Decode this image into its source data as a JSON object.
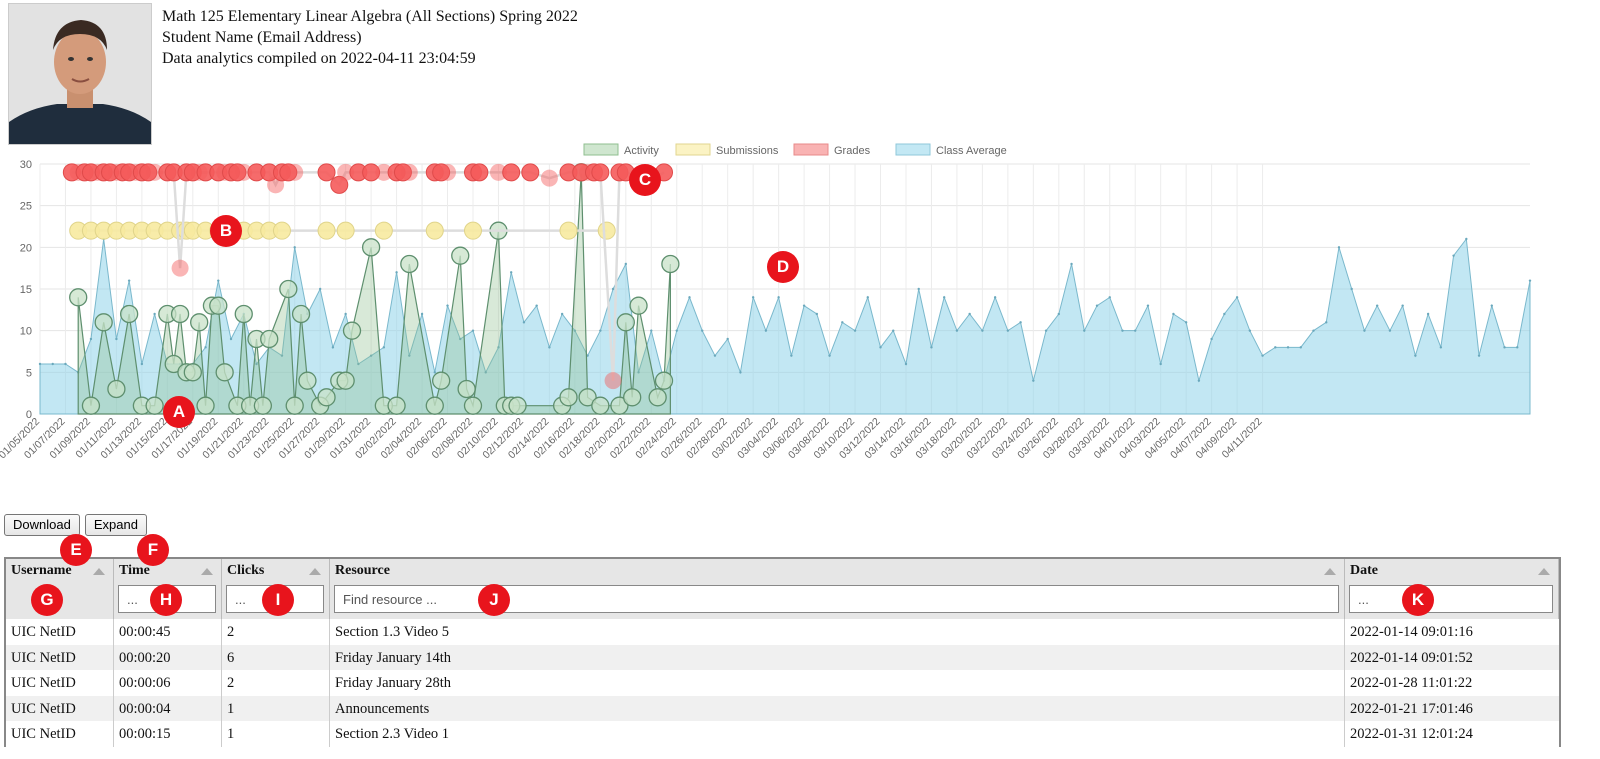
{
  "header": {
    "course": "Math 125 Elementary Linear Algebra (All Sections) Spring 2022",
    "student": "Student Name (Email Address)",
    "compiled": "Data analytics compiled on 2022-04-11 23:04:59"
  },
  "chart_data": {
    "type": "line",
    "legend": {
      "placement": "top-center",
      "items": [
        "Activity",
        "Submissions",
        "Grades",
        "Class Average"
      ]
    },
    "colors": {
      "Activity": "#8fbf8f",
      "Submissions": "#f7eaa0",
      "Grades": "#f55b5b",
      "Class Average": "#8fd3ea"
    },
    "ylim": [
      0,
      30
    ],
    "yticks": [
      0,
      5,
      10,
      15,
      20,
      25,
      30
    ],
    "xlabels": [
      "01/05/2022",
      "01/07/2022",
      "01/09/2022",
      "01/11/2022",
      "01/13/2022",
      "01/15/2022",
      "01/17/2022",
      "01/19/2022",
      "01/21/2022",
      "01/23/2022",
      "01/25/2022",
      "01/27/2022",
      "01/29/2022",
      "01/31/2022",
      "02/02/2022",
      "02/04/2022",
      "02/06/2022",
      "02/08/2022",
      "02/10/2022",
      "02/12/2022",
      "02/14/2022",
      "02/16/2022",
      "02/18/2022",
      "02/20/2022",
      "02/22/2022",
      "02/24/2022",
      "02/26/2022",
      "02/28/2022",
      "03/02/2022",
      "03/04/2022",
      "03/06/2022",
      "03/08/2022",
      "03/10/2022",
      "03/12/2022",
      "03/14/2022",
      "03/16/2022",
      "03/18/2022",
      "03/20/2022",
      "03/22/2022",
      "03/24/2022",
      "03/26/2022",
      "03/28/2022",
      "03/30/2022",
      "04/01/2022",
      "04/03/2022",
      "04/05/2022",
      "04/07/2022",
      "04/09/2022",
      "04/11/2022"
    ],
    "grid": true,
    "series": [
      {
        "name": "Class Average",
        "values": [
          6,
          6,
          6,
          5,
          9,
          21,
          9,
          16,
          6,
          12,
          6,
          6,
          6,
          8,
          16,
          9,
          12,
          6,
          8,
          7,
          20,
          12,
          15,
          8,
          12,
          6,
          7,
          8,
          17,
          7,
          12,
          5,
          13,
          9,
          10,
          5,
          8,
          17,
          11,
          13,
          8,
          12,
          10,
          7,
          10,
          15,
          18,
          5,
          10,
          4,
          10,
          14,
          10,
          7,
          9,
          5,
          14,
          10,
          14,
          7,
          13,
          12,
          7,
          11,
          10,
          14,
          8,
          10,
          6,
          15,
          8,
          14,
          10,
          12,
          10,
          14,
          10,
          11,
          4,
          10,
          12,
          18,
          10,
          13,
          14,
          10,
          10,
          13,
          6,
          12,
          11,
          4,
          9,
          12,
          14,
          10,
          7,
          8,
          8,
          8,
          10,
          11,
          20,
          15,
          10,
          13,
          10,
          13,
          7,
          12,
          8,
          19,
          21,
          7,
          13,
          8,
          8,
          16
        ]
      },
      {
        "name": "Activity",
        "points": [
          [
            3,
            14
          ],
          [
            4,
            1
          ],
          [
            5,
            11
          ],
          [
            6,
            3
          ],
          [
            7,
            12
          ],
          [
            8,
            1
          ],
          [
            9,
            1
          ],
          [
            10,
            12
          ],
          [
            10.5,
            6
          ],
          [
            11,
            12
          ],
          [
            11.5,
            5
          ],
          [
            12,
            5
          ],
          [
            12.5,
            11
          ],
          [
            13,
            1
          ],
          [
            13.5,
            13
          ],
          [
            14,
            13
          ],
          [
            14.5,
            5
          ],
          [
            15.5,
            1
          ],
          [
            16,
            12
          ],
          [
            16.5,
            1
          ],
          [
            17,
            9
          ],
          [
            17.5,
            1
          ],
          [
            18,
            9
          ],
          [
            19.5,
            15
          ],
          [
            20,
            1
          ],
          [
            20.5,
            12
          ],
          [
            21,
            4
          ],
          [
            22,
            1
          ],
          [
            22.5,
            2
          ],
          [
            23.5,
            4
          ],
          [
            24,
            4
          ],
          [
            24.5,
            10
          ],
          [
            26,
            20
          ],
          [
            27,
            1
          ],
          [
            28,
            1
          ],
          [
            29,
            18
          ],
          [
            31,
            1
          ],
          [
            31.5,
            4
          ],
          [
            33,
            19
          ],
          [
            33.5,
            3
          ],
          [
            34,
            1
          ],
          [
            36,
            22
          ],
          [
            36.5,
            1
          ],
          [
            37,
            1
          ],
          [
            37.5,
            1
          ],
          [
            41,
            1
          ],
          [
            41.5,
            2
          ],
          [
            42.5,
            29
          ],
          [
            43,
            2
          ],
          [
            44,
            1
          ],
          [
            45.5,
            1
          ],
          [
            46,
            11
          ],
          [
            46.5,
            2
          ],
          [
            47,
            13
          ],
          [
            48.5,
            2
          ],
          [
            49,
            4
          ],
          [
            49.5,
            18
          ]
        ]
      },
      {
        "name": "Submissions",
        "points": [
          [
            3,
            22
          ],
          [
            4,
            22
          ],
          [
            5,
            22
          ],
          [
            6,
            22
          ],
          [
            7,
            22
          ],
          [
            8,
            22
          ],
          [
            9,
            22
          ],
          [
            10,
            22
          ],
          [
            11,
            22
          ],
          [
            11.5,
            22
          ],
          [
            12,
            22
          ],
          [
            13,
            22
          ],
          [
            14,
            22
          ],
          [
            15,
            22
          ],
          [
            16,
            22
          ],
          [
            17,
            22
          ],
          [
            18,
            22
          ],
          [
            19,
            22
          ],
          [
            22.5,
            22
          ],
          [
            24,
            22
          ],
          [
            27,
            22
          ],
          [
            31,
            22
          ],
          [
            34,
            22
          ],
          [
            41.5,
            22
          ],
          [
            44.5,
            22
          ]
        ]
      },
      {
        "name": "Grades",
        "points": [
          [
            2.5,
            29
          ],
          [
            3,
            29
          ],
          [
            3.5,
            29
          ],
          [
            4,
            29
          ],
          [
            4.5,
            29
          ],
          [
            5,
            29
          ],
          [
            5.5,
            29
          ],
          [
            6,
            29
          ],
          [
            6.5,
            29
          ],
          [
            7,
            29
          ],
          [
            7.5,
            29
          ],
          [
            8,
            29
          ],
          [
            8.5,
            29
          ],
          [
            9,
            29
          ],
          [
            10,
            29
          ],
          [
            10.5,
            29
          ],
          [
            11,
            17.5
          ],
          [
            11.5,
            29
          ],
          [
            12,
            29
          ],
          [
            12.5,
            29
          ],
          [
            13,
            29
          ],
          [
            14,
            29
          ],
          [
            14.5,
            29
          ],
          [
            15,
            29
          ],
          [
            15.5,
            29
          ],
          [
            16,
            29
          ],
          [
            17,
            29
          ],
          [
            18,
            29
          ],
          [
            18.5,
            27.5
          ],
          [
            19,
            29
          ],
          [
            19.5,
            29
          ],
          [
            20,
            29
          ],
          [
            22.5,
            29
          ],
          [
            23.5,
            27.5
          ],
          [
            24,
            29
          ],
          [
            25,
            29
          ],
          [
            26,
            29
          ],
          [
            27,
            29
          ],
          [
            28,
            29
          ],
          [
            28.5,
            29
          ],
          [
            29,
            29
          ],
          [
            31,
            29
          ],
          [
            31.5,
            29
          ],
          [
            32,
            29
          ],
          [
            34,
            29
          ],
          [
            34.5,
            29
          ],
          [
            36,
            29
          ],
          [
            37,
            29
          ],
          [
            38.5,
            29
          ],
          [
            40,
            28.3
          ],
          [
            41.5,
            29
          ],
          [
            42.5,
            29
          ],
          [
            43,
            29
          ],
          [
            43.5,
            29
          ],
          [
            44,
            29
          ],
          [
            45,
            4
          ],
          [
            45.5,
            29
          ],
          [
            46,
            29
          ],
          [
            48,
            28
          ],
          [
            49,
            29
          ]
        ]
      }
    ]
  },
  "annotations": [
    "A",
    "B",
    "C",
    "D",
    "E",
    "F",
    "G",
    "H",
    "I",
    "J",
    "K"
  ],
  "buttons": {
    "download": "Download",
    "expand": "Expand"
  },
  "table": {
    "columns": [
      "Username",
      "Time",
      "Clicks",
      "Resource",
      "Date"
    ],
    "filters": {
      "time": "...",
      "clicks": "...",
      "resource": "Find resource ...",
      "date": "..."
    },
    "rows": [
      [
        "UIC NetID",
        "00:00:45",
        "2",
        "Section 1.3 Video 5",
        "2022-01-14 09:01:16"
      ],
      [
        "UIC NetID",
        "00:00:20",
        "6",
        "Friday January 14th",
        "2022-01-14 09:01:52"
      ],
      [
        "UIC NetID",
        "00:00:06",
        "2",
        "Friday January 28th",
        "2022-01-28 11:01:22"
      ],
      [
        "UIC NetID",
        "00:00:04",
        "1",
        "Announcements",
        "2022-01-21 17:01:46"
      ],
      [
        "UIC NetID",
        "00:00:15",
        "1",
        "Section 2.3 Video 1",
        "2022-01-31 12:01:24"
      ]
    ]
  }
}
